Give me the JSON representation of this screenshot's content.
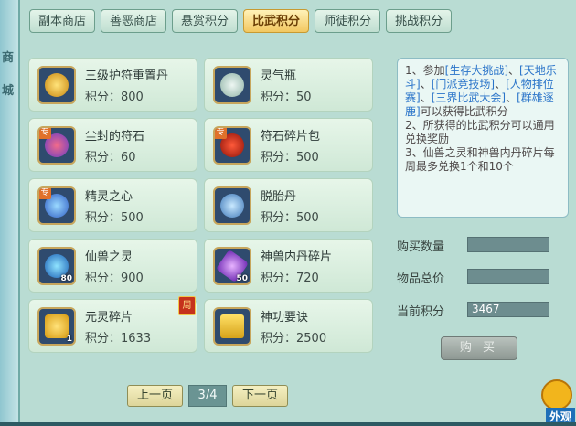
{
  "tabs": [
    {
      "label": "副本商店",
      "active": false
    },
    {
      "label": "善恶商店",
      "active": false
    },
    {
      "label": "悬赏积分",
      "active": false
    },
    {
      "label": "比武积分",
      "active": true
    },
    {
      "label": "师徒积分",
      "active": false
    },
    {
      "label": "挑战积分",
      "active": false
    }
  ],
  "edge_text": [
    "商",
    "城"
  ],
  "items": [
    {
      "name": "三级护符重置丹",
      "price": "积分：800",
      "icon": "charm-pill-icon",
      "qty": "",
      "tag": ""
    },
    {
      "name": "灵气瓶",
      "price": "积分：50",
      "icon": "spirit-vase-icon",
      "qty": "",
      "tag": ""
    },
    {
      "name": "尘封的符石",
      "price": "积分：60",
      "icon": "rune-stone-icon",
      "qty": "",
      "tag": "专"
    },
    {
      "name": "符石碎片包",
      "price": "积分：500",
      "icon": "rune-pouch-icon",
      "qty": "",
      "tag": "专"
    },
    {
      "name": "精灵之心",
      "price": "积分：500",
      "icon": "sprite-heart-icon",
      "qty": "",
      "tag": "专"
    },
    {
      "name": "脱胎丹",
      "price": "积分：500",
      "icon": "rebirth-pill-icon",
      "qty": "",
      "tag": ""
    },
    {
      "name": "仙兽之灵",
      "price": "积分：900",
      "icon": "beast-orb-icon",
      "qty": "80",
      "tag": ""
    },
    {
      "name": "神兽内丹碎片",
      "price": "积分：720",
      "icon": "beast-crystal-icon",
      "qty": "50",
      "tag": ""
    },
    {
      "name": "元灵碎片",
      "price": "积分：1633",
      "icon": "yuanling-shard-icon",
      "qty": "1",
      "tag": "",
      "weekly": "周"
    },
    {
      "name": "神功要诀",
      "price": "积分：2500",
      "icon": "skill-book-icon",
      "qty": "",
      "tag": ""
    }
  ],
  "rules": {
    "l1a": "1、参加",
    "l1b": "[生存大挑战]",
    "l1c": "、",
    "l1d": "[天地乐斗]",
    "l1e": "、",
    "l1f": "[门派竞技场]",
    "l1g": "、",
    "l1h": "[人物排位赛]",
    "l1i": "、",
    "l1j": "[三界比武大会]",
    "l1k": "、",
    "l1l": "[群雄逐鹿]",
    "l1m": "可以获得比武积分",
    "l2": "2、所获得的比武积分可以通用兑换奖励",
    "l3": "3、仙兽之灵和神兽内丹碎片每周最多兑换1个和10个"
  },
  "form": {
    "buy_qty_label": "购买数量",
    "buy_qty_value": "",
    "total_label": "物品总价",
    "total_value": "",
    "current_label": "当前积分",
    "current_value": "3467"
  },
  "buy_button": "购 买",
  "pager": {
    "prev": "上一页",
    "page": "3/4",
    "next": "下一页"
  },
  "corner_label": "外观",
  "colors": {
    "active_tab": "#f2c760",
    "panel": "#b9dcd3",
    "highlight_text": "#2a74c9"
  }
}
